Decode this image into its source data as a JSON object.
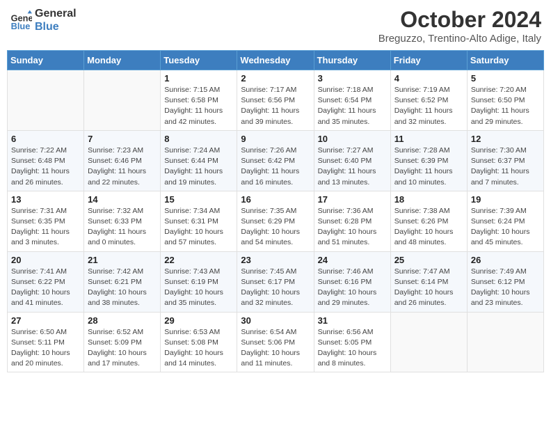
{
  "header": {
    "logo_line1": "General",
    "logo_line2": "Blue",
    "month_year": "October 2024",
    "location": "Breguzzo, Trentino-Alto Adige, Italy"
  },
  "days_of_week": [
    "Sunday",
    "Monday",
    "Tuesday",
    "Wednesday",
    "Thursday",
    "Friday",
    "Saturday"
  ],
  "weeks": [
    [
      {
        "day": "",
        "info": ""
      },
      {
        "day": "",
        "info": ""
      },
      {
        "day": "1",
        "info": "Sunrise: 7:15 AM\nSunset: 6:58 PM\nDaylight: 11 hours and 42 minutes."
      },
      {
        "day": "2",
        "info": "Sunrise: 7:17 AM\nSunset: 6:56 PM\nDaylight: 11 hours and 39 minutes."
      },
      {
        "day": "3",
        "info": "Sunrise: 7:18 AM\nSunset: 6:54 PM\nDaylight: 11 hours and 35 minutes."
      },
      {
        "day": "4",
        "info": "Sunrise: 7:19 AM\nSunset: 6:52 PM\nDaylight: 11 hours and 32 minutes."
      },
      {
        "day": "5",
        "info": "Sunrise: 7:20 AM\nSunset: 6:50 PM\nDaylight: 11 hours and 29 minutes."
      }
    ],
    [
      {
        "day": "6",
        "info": "Sunrise: 7:22 AM\nSunset: 6:48 PM\nDaylight: 11 hours and 26 minutes."
      },
      {
        "day": "7",
        "info": "Sunrise: 7:23 AM\nSunset: 6:46 PM\nDaylight: 11 hours and 22 minutes."
      },
      {
        "day": "8",
        "info": "Sunrise: 7:24 AM\nSunset: 6:44 PM\nDaylight: 11 hours and 19 minutes."
      },
      {
        "day": "9",
        "info": "Sunrise: 7:26 AM\nSunset: 6:42 PM\nDaylight: 11 hours and 16 minutes."
      },
      {
        "day": "10",
        "info": "Sunrise: 7:27 AM\nSunset: 6:40 PM\nDaylight: 11 hours and 13 minutes."
      },
      {
        "day": "11",
        "info": "Sunrise: 7:28 AM\nSunset: 6:39 PM\nDaylight: 11 hours and 10 minutes."
      },
      {
        "day": "12",
        "info": "Sunrise: 7:30 AM\nSunset: 6:37 PM\nDaylight: 11 hours and 7 minutes."
      }
    ],
    [
      {
        "day": "13",
        "info": "Sunrise: 7:31 AM\nSunset: 6:35 PM\nDaylight: 11 hours and 3 minutes."
      },
      {
        "day": "14",
        "info": "Sunrise: 7:32 AM\nSunset: 6:33 PM\nDaylight: 11 hours and 0 minutes."
      },
      {
        "day": "15",
        "info": "Sunrise: 7:34 AM\nSunset: 6:31 PM\nDaylight: 10 hours and 57 minutes."
      },
      {
        "day": "16",
        "info": "Sunrise: 7:35 AM\nSunset: 6:29 PM\nDaylight: 10 hours and 54 minutes."
      },
      {
        "day": "17",
        "info": "Sunrise: 7:36 AM\nSunset: 6:28 PM\nDaylight: 10 hours and 51 minutes."
      },
      {
        "day": "18",
        "info": "Sunrise: 7:38 AM\nSunset: 6:26 PM\nDaylight: 10 hours and 48 minutes."
      },
      {
        "day": "19",
        "info": "Sunrise: 7:39 AM\nSunset: 6:24 PM\nDaylight: 10 hours and 45 minutes."
      }
    ],
    [
      {
        "day": "20",
        "info": "Sunrise: 7:41 AM\nSunset: 6:22 PM\nDaylight: 10 hours and 41 minutes."
      },
      {
        "day": "21",
        "info": "Sunrise: 7:42 AM\nSunset: 6:21 PM\nDaylight: 10 hours and 38 minutes."
      },
      {
        "day": "22",
        "info": "Sunrise: 7:43 AM\nSunset: 6:19 PM\nDaylight: 10 hours and 35 minutes."
      },
      {
        "day": "23",
        "info": "Sunrise: 7:45 AM\nSunset: 6:17 PM\nDaylight: 10 hours and 32 minutes."
      },
      {
        "day": "24",
        "info": "Sunrise: 7:46 AM\nSunset: 6:16 PM\nDaylight: 10 hours and 29 minutes."
      },
      {
        "day": "25",
        "info": "Sunrise: 7:47 AM\nSunset: 6:14 PM\nDaylight: 10 hours and 26 minutes."
      },
      {
        "day": "26",
        "info": "Sunrise: 7:49 AM\nSunset: 6:12 PM\nDaylight: 10 hours and 23 minutes."
      }
    ],
    [
      {
        "day": "27",
        "info": "Sunrise: 6:50 AM\nSunset: 5:11 PM\nDaylight: 10 hours and 20 minutes."
      },
      {
        "day": "28",
        "info": "Sunrise: 6:52 AM\nSunset: 5:09 PM\nDaylight: 10 hours and 17 minutes."
      },
      {
        "day": "29",
        "info": "Sunrise: 6:53 AM\nSunset: 5:08 PM\nDaylight: 10 hours and 14 minutes."
      },
      {
        "day": "30",
        "info": "Sunrise: 6:54 AM\nSunset: 5:06 PM\nDaylight: 10 hours and 11 minutes."
      },
      {
        "day": "31",
        "info": "Sunrise: 6:56 AM\nSunset: 5:05 PM\nDaylight: 10 hours and 8 minutes."
      },
      {
        "day": "",
        "info": ""
      },
      {
        "day": "",
        "info": ""
      }
    ]
  ]
}
